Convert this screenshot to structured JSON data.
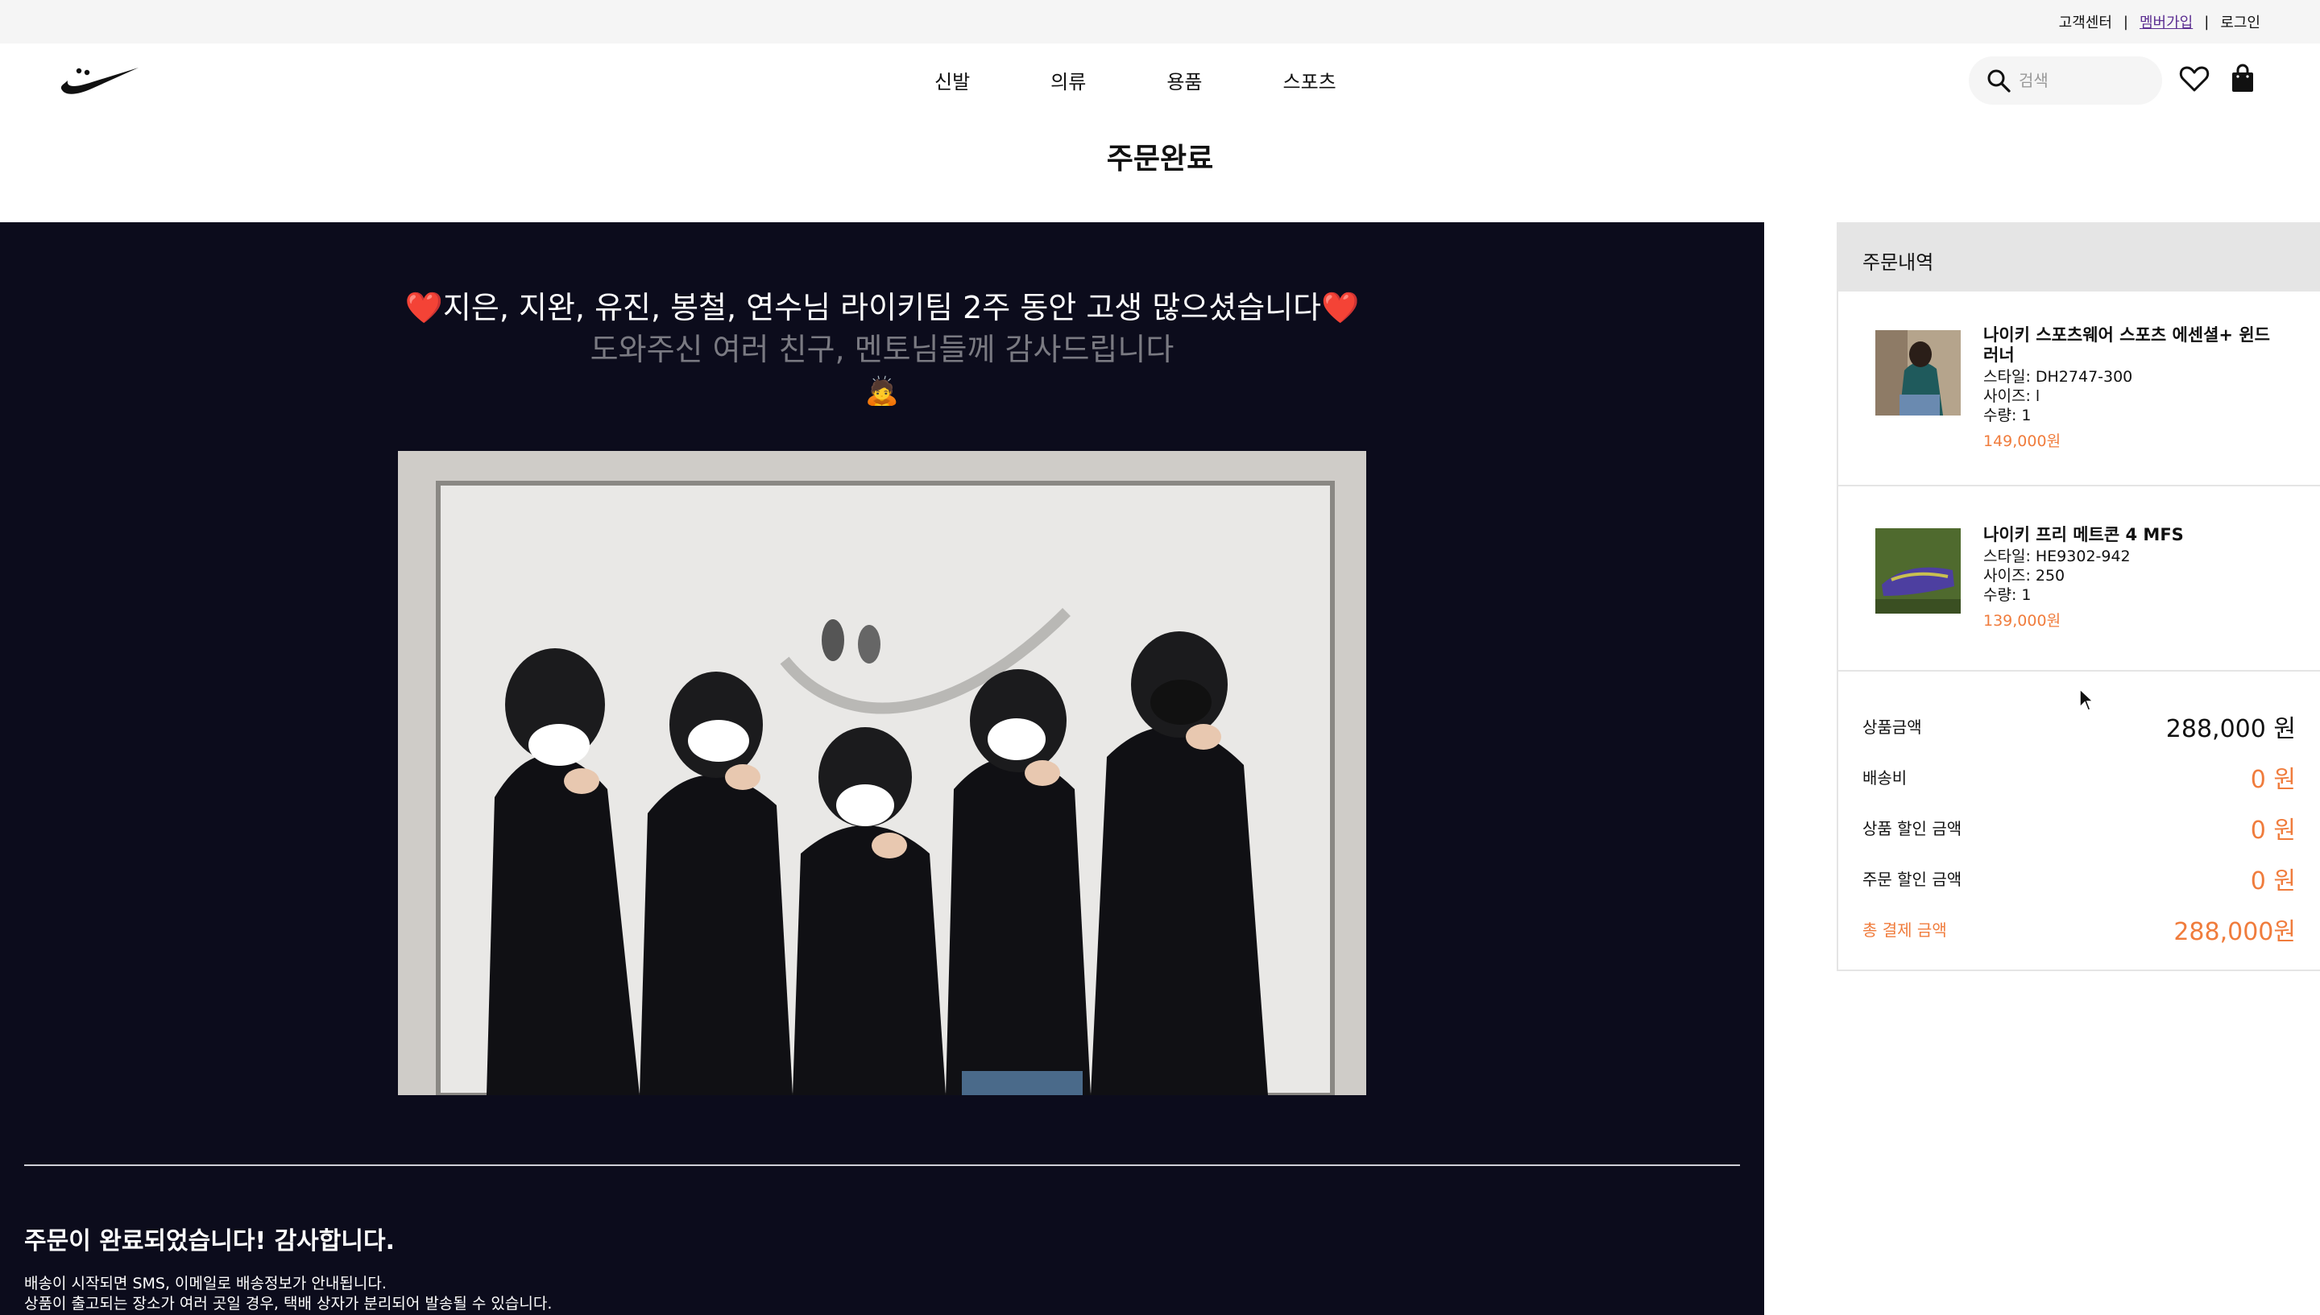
{
  "util_bar": {
    "support": "고객센터",
    "signup": "멤버가입",
    "login": "로그인",
    "sep": "|"
  },
  "header": {
    "logo": "nike-swoosh-smile-logo",
    "nav": [
      "신발",
      "의류",
      "용품",
      "스포츠"
    ],
    "search_placeholder": "검색"
  },
  "page_title": "주문완료",
  "thanks": {
    "heart": "❤️",
    "line1": "지은, 지완, 유진, 봉철, 연수님 라이키팀 2주 동안 고생 많으셨습니다",
    "line2": "도와주신 여러 친구, 멘토님들께 감사드립니다",
    "emoji": "🙇"
  },
  "confirmation": {
    "title": "주문이 완료되었습니다! 감사합니다.",
    "line1": "배송이 시작되면 SMS, 이메일로 배송정보가 안내됩니다.",
    "line2": "상품이 출고되는 장소가 여러 곳일 경우, 택배 상자가 분리되어 발송될 수 있습니다."
  },
  "summary": {
    "title": "주문내역",
    "items": [
      {
        "name": "나이키 스포츠웨어 스포츠 에센셜+ 윈드러너",
        "style": "스타일: DH2747-300",
        "size": "사이즈: l",
        "qty": "수량: 1",
        "price": "149,000원"
      },
      {
        "name": "나이키 프리 메트콘 4 MFS",
        "style": "스타일: HE9302-942",
        "size": "사이즈: 250",
        "qty": "수량: 1",
        "price": "139,000원"
      }
    ],
    "rows": [
      {
        "label": "상품금액",
        "value": "288,000 원"
      },
      {
        "label": "배송비",
        "value": "0 원"
      },
      {
        "label": "상품 할인 금액",
        "value": "0 원"
      },
      {
        "label": "주문 할인 금액",
        "value": "0 원"
      },
      {
        "label": "총 결제 금액",
        "value": "288,000원"
      }
    ]
  },
  "colors": {
    "accent": "#f07c3c",
    "panel": "#0c0c1c",
    "signup_link": "#5a2d91"
  }
}
